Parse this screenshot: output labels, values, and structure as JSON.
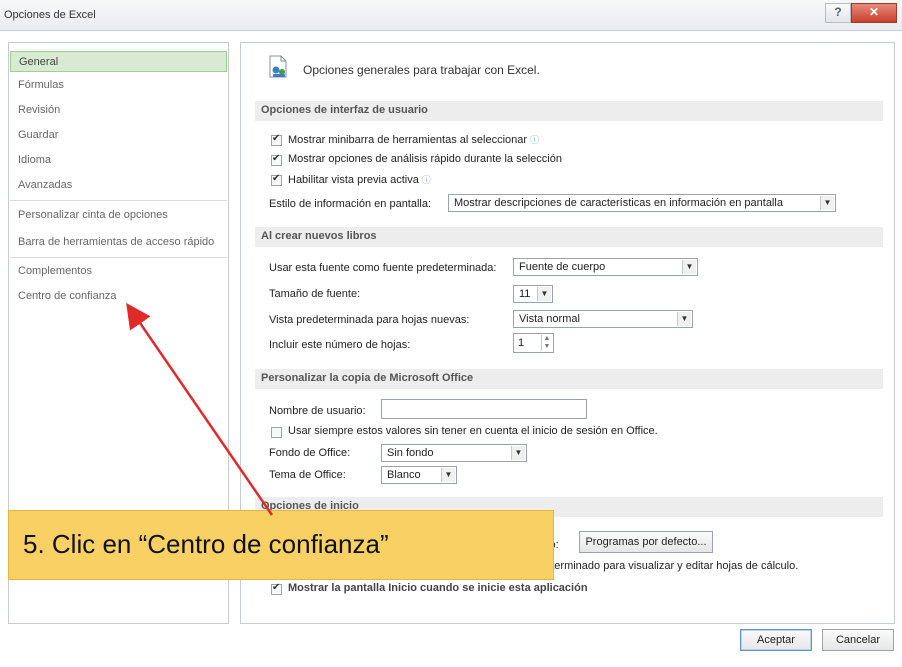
{
  "window": {
    "title": "Opciones de Excel",
    "help_label": "?",
    "close_label": "✕"
  },
  "sidebar": {
    "items": [
      {
        "label": "General"
      },
      {
        "label": "Fórmulas"
      },
      {
        "label": "Revisión"
      },
      {
        "label": "Guardar"
      },
      {
        "label": "Idioma"
      },
      {
        "label": "Avanzadas"
      },
      {
        "label": "Personalizar cinta de opciones"
      },
      {
        "label": "Barra de herramientas de acceso rápido"
      },
      {
        "label": "Complementos"
      },
      {
        "label": "Centro de confianza"
      }
    ],
    "selected_index": 0
  },
  "content": {
    "heading": "Opciones generales para trabajar con Excel.",
    "ui_options": {
      "section_title": "Opciones de interfaz de usuario",
      "minibar_label": "Mostrar minibarra de herramientas al seleccionar",
      "minibar_checked": true,
      "quick_analysis_label": "Mostrar opciones de análisis rápido durante la selección",
      "quick_analysis_checked": true,
      "live_preview_label": "Habilitar vista previa activa",
      "live_preview_checked": true,
      "screentip_label": "Estilo de información en pantalla:",
      "screentip_value": "Mostrar descripciones de características en información en pantalla"
    },
    "new_workbooks": {
      "section_title": "Al crear nuevos libros",
      "font_label": "Usar esta fuente como fuente predeterminada:",
      "font_value": "Fuente de cuerpo",
      "size_label": "Tamaño de fuente:",
      "size_value": "11",
      "view_label": "Vista predeterminada para hojas nuevas:",
      "view_value": "Vista normal",
      "sheets_label": "Incluir este número de hojas:",
      "sheets_value": "1"
    },
    "personalize": {
      "section_title": "Personalizar la copia de Microsoft Office",
      "username_label": "Nombre de usuario:",
      "username_value": "",
      "always_use_label": "Usar siempre estos valores sin tener en cuenta el inicio de sesión en Office.",
      "always_use_checked": false,
      "background_label": "Fondo de Office:",
      "background_value": "Sin fondo",
      "theme_label": "Tema de Office:",
      "theme_value": "Blanco"
    },
    "startup": {
      "section_title": "Opciones de inicio",
      "default_programs_suffix": "cto:",
      "default_programs_button": "Programas por defecto...",
      "default_viewer_text": "determinado para visualizar y editar hojas de cálculo.",
      "show_start_text": "Mostrar la pantalla Inicio cuando se inicie esta aplicación"
    }
  },
  "footer": {
    "ok_label": "Aceptar",
    "cancel_label": "Cancelar"
  },
  "annotation": {
    "text": "5. Clic en “Centro de confianza”",
    "arrow_color": "#e02a2a",
    "banner_color": "#f8d063"
  }
}
